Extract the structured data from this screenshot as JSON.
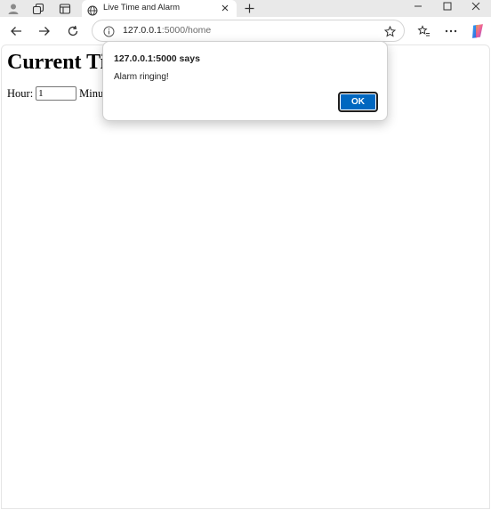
{
  "browser": {
    "tab": {
      "title": "Live Time and Alarm"
    },
    "address_bar": {
      "host": "127.0.0.1",
      "path": ":5000/home"
    }
  },
  "page": {
    "title": "Current Ti",
    "hour_label": "Hour:",
    "hour_value": "1",
    "minute_label": "Minut"
  },
  "dialog": {
    "title": "127.0.0.1:5000 says",
    "message": "Alarm ringing!",
    "ok_label": "OK"
  },
  "colors": {
    "ok_button": "#0067c0",
    "tabstrip": "#e9e9e9"
  }
}
